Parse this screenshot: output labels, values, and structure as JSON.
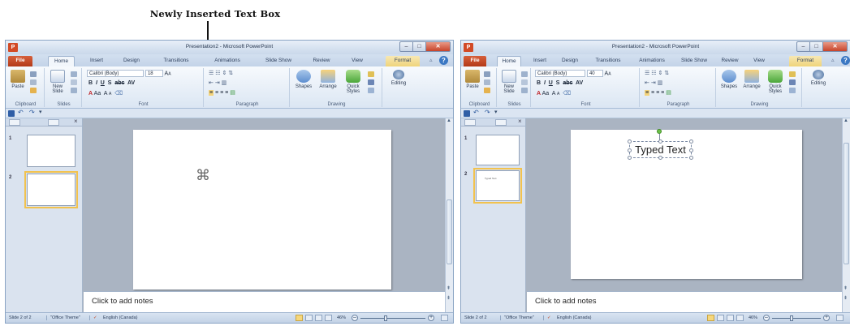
{
  "caption": "Newly Inserted Text Box",
  "windows": [
    {
      "app_icon": "P",
      "title": "Presentation2 - Microsoft PowerPoint",
      "controls": {
        "minimize": "–",
        "maximize": "□",
        "close": "✕"
      },
      "tabs": [
        "File",
        "Home",
        "Insert",
        "Design",
        "Transitions",
        "Animations",
        "Slide Show",
        "Review",
        "View",
        "Format"
      ],
      "active_tab": "Home",
      "ribbon": {
        "paste": "Paste",
        "new_slide": "New Slide",
        "font_name": "Calibri (Body)",
        "font_size": "18",
        "shapes": "Shapes",
        "arrange": "Arrange",
        "quick_styles": "Quick Styles",
        "editing": "Editing",
        "groups": [
          "Clipboard",
          "Slides",
          "Font",
          "Paragraph",
          "Drawing"
        ]
      },
      "qat": {
        "undo": "↶",
        "redo": "↷",
        "more": "▾"
      },
      "thumbnails": [
        {
          "number": "1",
          "selected": false,
          "text": ""
        },
        {
          "number": "2",
          "selected": true,
          "text": ""
        }
      ],
      "slide_content": {
        "mode": "new_textbox",
        "text": ""
      },
      "notes": "Click to add notes",
      "status": {
        "slide": "Slide 2 of 2",
        "theme": "\"Office Theme\"",
        "language": "English (Canada)",
        "zoom": "46%",
        "zoom_in": "+",
        "zoom_out": "–"
      }
    },
    {
      "app_icon": "P",
      "title": "Presentation2 - Microsoft PowerPoint",
      "controls": {
        "minimize": "–",
        "maximize": "□",
        "close": "✕"
      },
      "tabs": [
        "File",
        "Home",
        "Insert",
        "Design",
        "Transitions",
        "Animations",
        "Slide Show",
        "Review",
        "View",
        "Format"
      ],
      "active_tab": "Home",
      "ribbon": {
        "paste": "Paste",
        "new_slide": "New Slide",
        "font_name": "Calibri (Body)",
        "font_size": "40",
        "shapes": "Shapes",
        "arrange": "Arrange",
        "quick_styles": "Quick Styles",
        "editing": "Editing",
        "groups": [
          "Clipboard",
          "Slides",
          "Font",
          "Paragraph",
          "Drawing"
        ]
      },
      "qat": {
        "undo": "↶",
        "redo": "↷",
        "more": "▾"
      },
      "thumbnails": [
        {
          "number": "1",
          "selected": false,
          "text": ""
        },
        {
          "number": "2",
          "selected": true,
          "text": "Typed Text"
        }
      ],
      "slide_content": {
        "mode": "typed_textbox",
        "text": "Typed Text"
      },
      "notes": "Click to add notes",
      "status": {
        "slide": "Slide 2 of 2",
        "theme": "\"Office Theme\"",
        "language": "English (Canada)",
        "zoom": "46%",
        "zoom_in": "+",
        "zoom_out": "–"
      }
    }
  ],
  "colors": {
    "file_tab": "#c0451f",
    "title_bar": "#d3e0f0",
    "ribbon": "#e8f0f8",
    "slide_area": "#aab4c2",
    "rotation_handle": "#6cc24a",
    "selected_thumbnail": "#f2c24e"
  }
}
